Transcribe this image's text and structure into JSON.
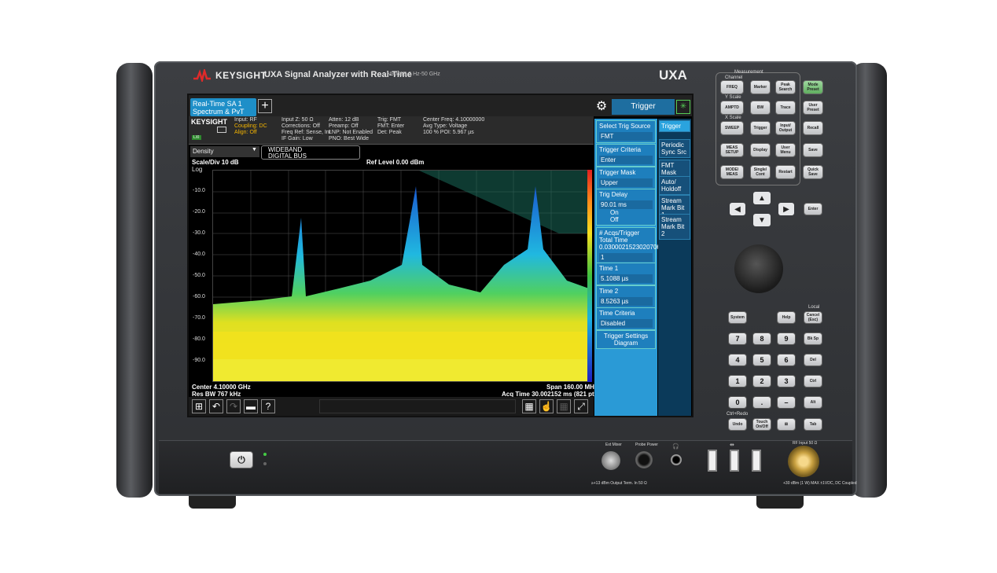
{
  "instrument": {
    "brand": "KEYSIGHT",
    "title": "UXA Signal Analyzer with Real-Time",
    "model_sub": "N9040B  3 Hz-50 GHz",
    "badge": "UXA"
  },
  "screen": {
    "tab": {
      "line1": "Real-Time SA 1",
      "line2": "Spectrum & PvT"
    },
    "add_label": "+",
    "gear_label": "⚙",
    "trigger_tab": "Trigger",
    "info": {
      "logo": "KEYSIGHT",
      "lxi": "LXI",
      "col1": [
        "Input: RF",
        "Coupling: DC",
        "Align: Off"
      ],
      "col2": [
        "Input Z: 50 Ω",
        "Corrections: Off",
        "Freq Ref: Sense, Int",
        "IF Gain: Low"
      ],
      "col3": [
        "Atten: 12 dB",
        "Preamp: Off",
        "LNP: Not Enabled",
        "PNO: Best Wide"
      ],
      "col4": [
        "Trig: FMT",
        "FMT: Enter",
        "Det: Peak"
      ],
      "col5": [
        "Center Freq: 4.10000000",
        "Avg Type: Voltage",
        "100 % POI: 5.967 µs"
      ]
    },
    "density": "Density",
    "wideband": {
      "line1": "WIDEBAND",
      "line2": "DIGITAL BUS"
    },
    "scale": "Scale/Div 10 dB",
    "log": "Log",
    "ref_level": "Ref Level 0.00 dBm",
    "y_ticks": [
      "-10.0",
      "-20.0",
      "-30.0",
      "-40.0",
      "-50.0",
      "-60.0",
      "-70.0",
      "-80.0",
      "-90.0"
    ],
    "center": "Center 4.10000 GHz",
    "res_bw": "Res BW 767 kHz",
    "span": "Span 160.00 MHz",
    "acq_time": "Acq Time 30.002152 ms (821 pts)",
    "trigger_panel": {
      "select_source": {
        "label": "Select Trig Source",
        "value": "FMT"
      },
      "criteria": {
        "label": "Trigger Criteria",
        "value": "Enter"
      },
      "mask": {
        "label": "Trigger Mask",
        "value": "Upper"
      },
      "delay": {
        "label": "Trig Delay",
        "value": "90.01 ms",
        "on": "On",
        "off": "Off"
      },
      "acqs": {
        "label": "# Acqs/Trigger",
        "sub": "Total Time",
        "total": "0.0300021523020706",
        "value": "1"
      },
      "time1": {
        "label": "Time 1",
        "value": "5.1088 µs"
      },
      "time2": {
        "label": "Time 2",
        "value": "8.5263 µs"
      },
      "time_criteria": {
        "label": "Time Criteria",
        "value": "Disabled"
      },
      "diagram": {
        "line1": "Trigger Settings",
        "line2": "Diagram"
      }
    },
    "softkeys": [
      "Trigger",
      "Periodic Sync Src",
      "FMT Mask",
      "Auto/ Holdoff",
      "Stream Mark Bit 1",
      "Stream Mark Bit 2"
    ]
  },
  "keys": {
    "measurement": "Measurement",
    "channel": "Channel",
    "yscale": "Y Scale",
    "xscale": "X Scale",
    "freq": "FREQ",
    "marker": "Marker",
    "peak": "Peak Search",
    "mode_preset": "Mode Preset",
    "amptd": "AMPTD",
    "bw": "BW",
    "trace": "Trace",
    "user_preset": "User Preset",
    "sweep": "SWEEP",
    "trigger": "Trigger",
    "input_output": "Input/ Output",
    "recall": "Recall",
    "meas_setup": "MEAS SETUP",
    "display": "Display",
    "user_menu": "User Menu",
    "save": "Save",
    "mode_meas": "MODE/ MEAS",
    "single_cont": "Single/ Cont",
    "restart": "Restart",
    "quick_save": "Quick Save",
    "enter": "Enter",
    "system": "System",
    "help": "Help",
    "local": "Local",
    "cancel": "Cancel (Esc)",
    "digits": [
      "7",
      "8",
      "9",
      "4",
      "5",
      "6",
      "1",
      "2",
      "3",
      "0",
      ".",
      "–"
    ],
    "bksp": "Bk Sp",
    "del": "Del",
    "ctrl": "Ctrl",
    "alt": "Alt",
    "ctrl_redo": "Ctrl+Redo",
    "undo": "Undo",
    "touch": "Touch On/Off",
    "tab": "Tab"
  },
  "front": {
    "ext_mixer": "Ext Mixer",
    "probe_power": "Probe Power",
    "output_warn": "≥+13 dBm Output Term. In 50 Ω",
    "rf_input": "RF Input 50 Ω",
    "rf_warn": "+30 dBm (1 W) MAX ±1VDC, DC Coupled"
  }
}
